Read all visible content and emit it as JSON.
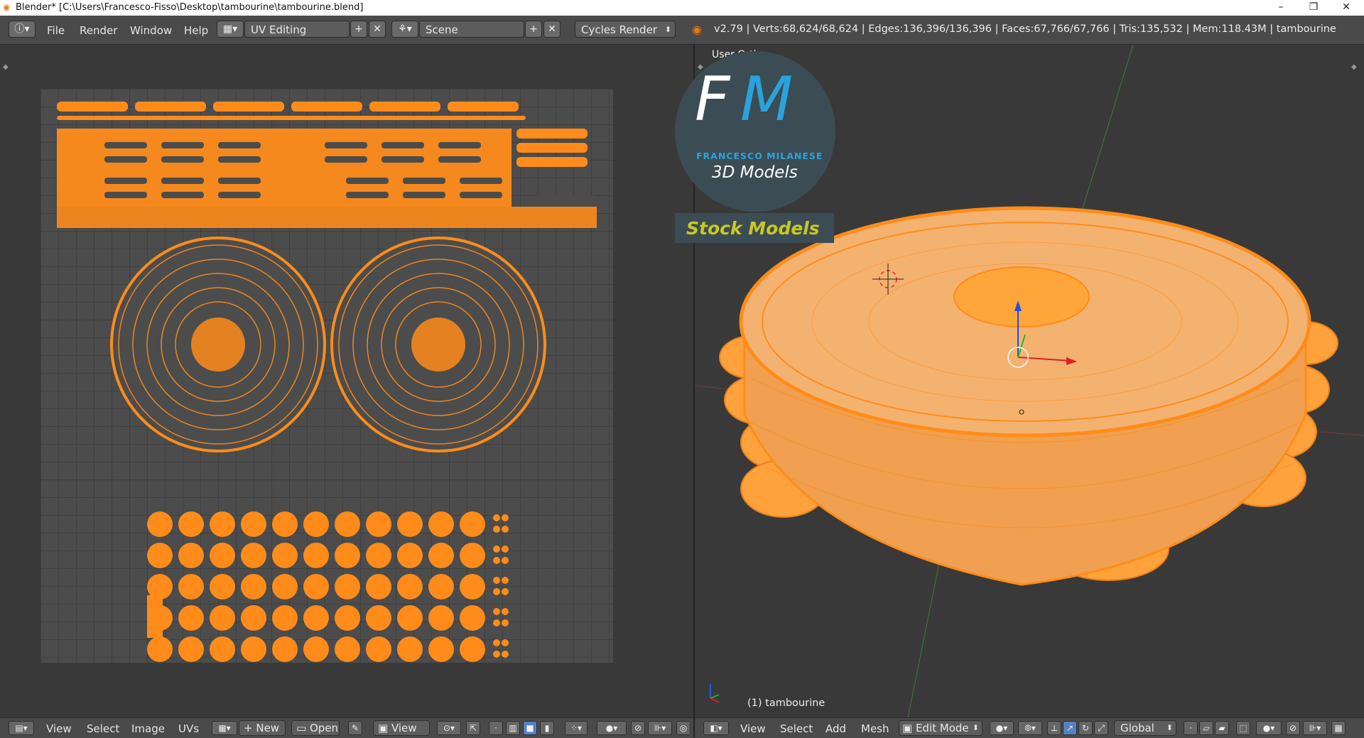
{
  "window": {
    "title": "Blender* [C:\\Users\\Francesco-Fisso\\Desktop\\tambourine\\tambourine.blend]",
    "controls": [
      "–",
      "❐",
      "✕"
    ]
  },
  "info_header": {
    "menus": [
      "File",
      "Render",
      "Window",
      "Help"
    ],
    "screen_layout": "UV Editing",
    "scene": "Scene",
    "render_engine": "Cycles Render",
    "stats": "v2.79 | Verts:68,624/68,624 | Edges:136,396/136,396 | Faces:67,766/67,766 | Tris:135,532 | Mem:118.43M | tambourine"
  },
  "viewport": {
    "view_label": "User Ortho",
    "object_label": "(1) tambourine"
  },
  "logo": {
    "initials_1": "F",
    "initials_2": "M",
    "brand": "FRANCESCO MILANESE",
    "tagline": "3D Models",
    "banner": "Stock Models"
  },
  "uv_footer": {
    "menus": [
      "View",
      "Select",
      "Image",
      "UVs"
    ],
    "new_label": "New",
    "open_label": "Open",
    "view_label": "View"
  },
  "view3d_footer": {
    "menus": [
      "View",
      "Select",
      "Add",
      "Mesh"
    ],
    "mode": "Edit Mode",
    "orientation": "Global"
  },
  "colors": {
    "accent": "#ff8c1a",
    "panel": "#4a4a4a",
    "background": "#393939",
    "logo_bg": "#3c4c54",
    "logo_blue": "#2aa3dc",
    "banner_text": "#c8c824"
  }
}
